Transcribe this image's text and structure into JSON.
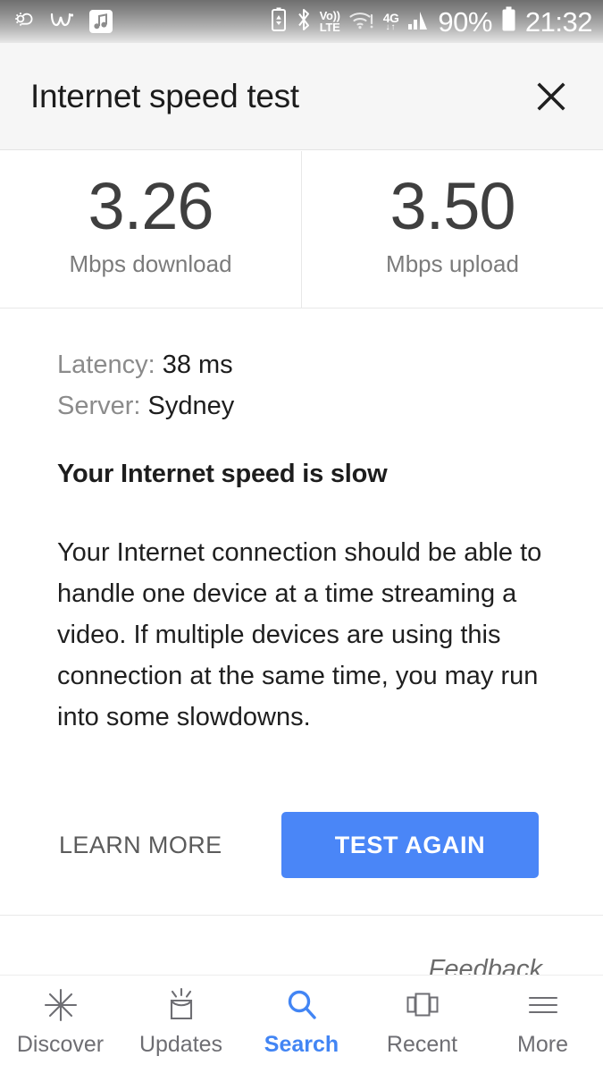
{
  "status_bar": {
    "left_icons": [
      "weather-icon",
      "w-app-icon",
      "music-note-icon"
    ],
    "battery_saver_icon": "battery-saver-icon",
    "bluetooth_icon": "bluetooth-icon",
    "volte": {
      "top": "Vo))",
      "bottom": "LTE"
    },
    "wifi_icon": "wifi-warning-icon",
    "network": {
      "type": "4G",
      "arrows": "↓↑"
    },
    "signal_icon": "signal-bars-icon",
    "battery_percent": "90%",
    "battery_icon": "battery-icon",
    "time": "21:32"
  },
  "header": {
    "title": "Internet speed test",
    "close_label": "close"
  },
  "results": [
    {
      "value": "3.26",
      "label": "Mbps download"
    },
    {
      "value": "3.50",
      "label": "Mbps upload"
    }
  ],
  "details": {
    "latency_label": "Latency:",
    "latency_value": "38 ms",
    "server_label": "Server:",
    "server_value": "Sydney"
  },
  "summary": {
    "headline": "Your Internet speed is slow",
    "body": "Your Internet connection should be able to handle one device at a time streaming a video. If multiple devices are using this connection at the same time, you may run into some slowdowns."
  },
  "actions": {
    "learn_more": "LEARN MORE",
    "test_again": "TEST AGAIN"
  },
  "feedback": "Feedback",
  "nav": {
    "items": [
      {
        "label": "Discover",
        "icon": "asterisk-icon",
        "active": false
      },
      {
        "label": "Updates",
        "icon": "inbox-icon",
        "active": false
      },
      {
        "label": "Search",
        "icon": "search-icon",
        "active": true
      },
      {
        "label": "Recent",
        "icon": "cards-icon",
        "active": false
      },
      {
        "label": "More",
        "icon": "hamburger-icon",
        "active": false
      }
    ]
  },
  "colors": {
    "accent": "#4285f4",
    "button": "#4a86f7",
    "header_bg": "#f6f6f6",
    "value_text": "#3f3f3f",
    "muted_text": "#8b8b8b"
  }
}
